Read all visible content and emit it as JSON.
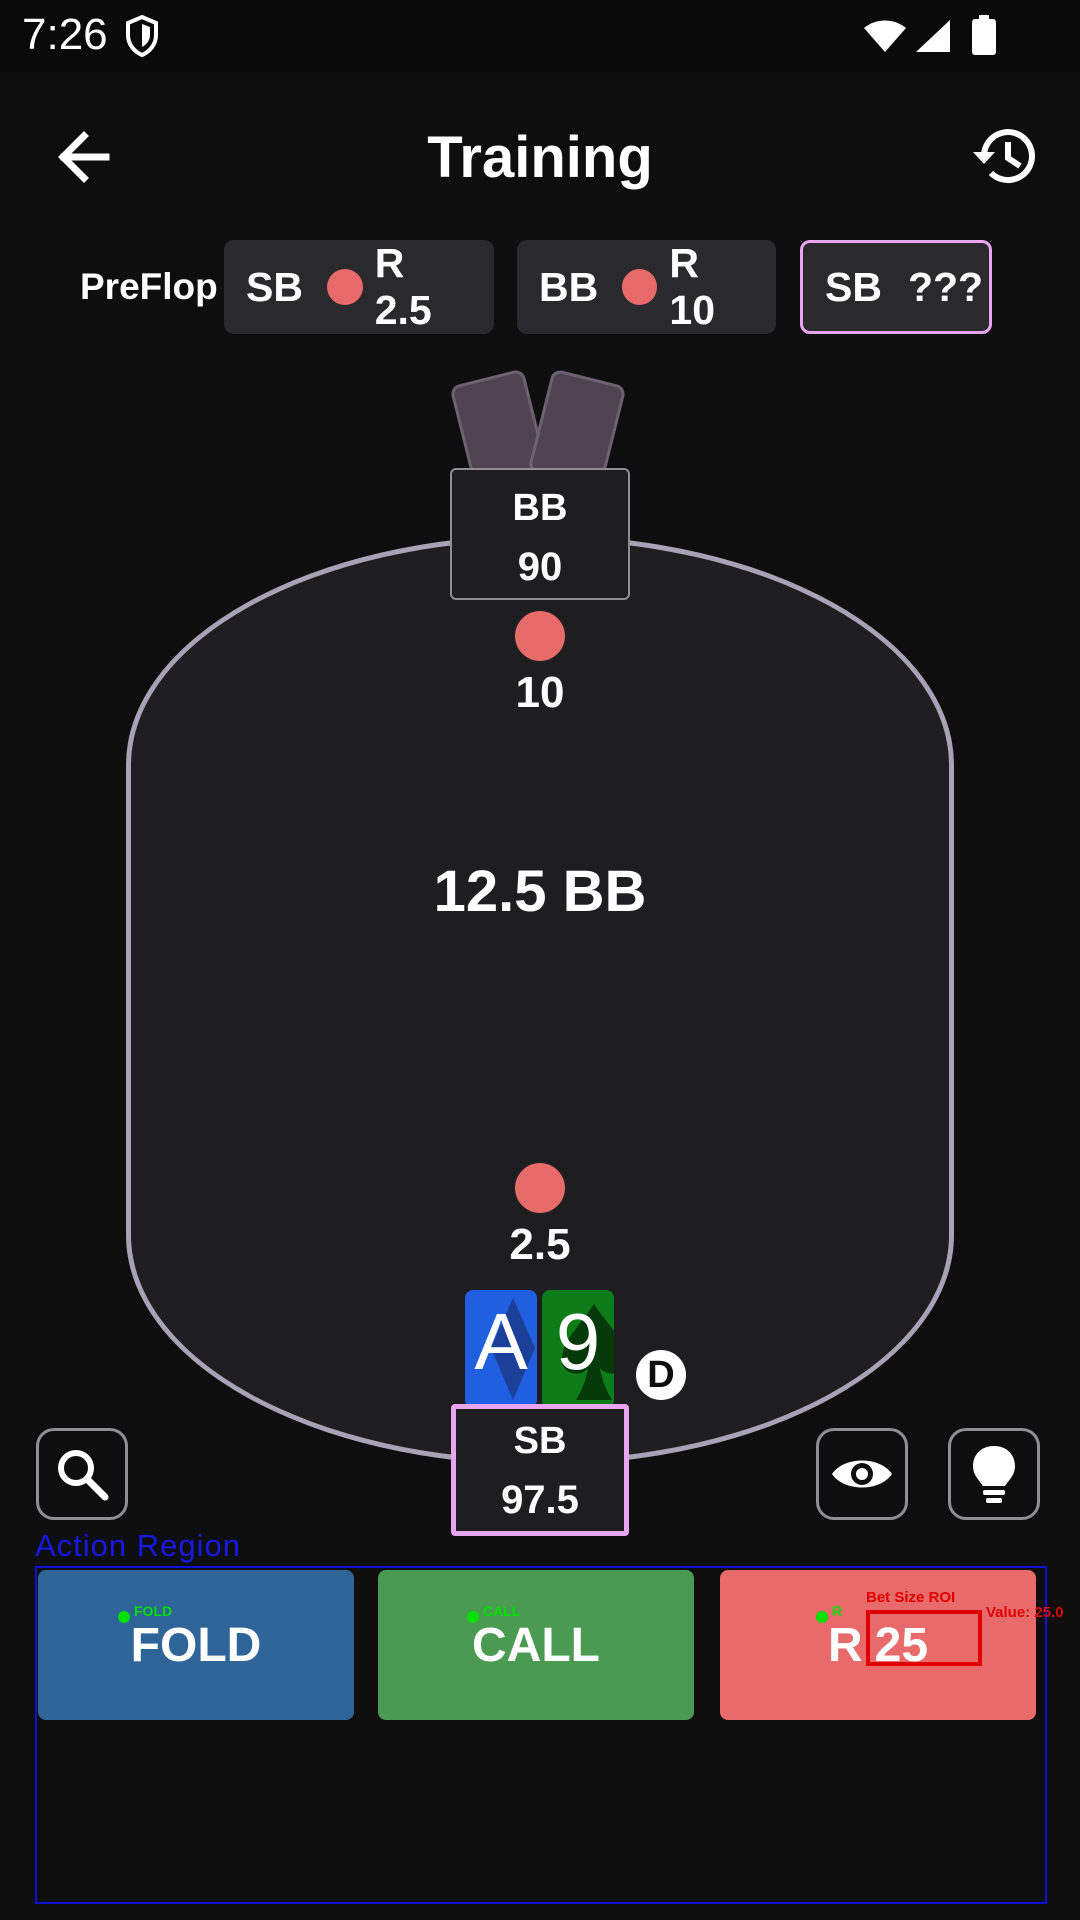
{
  "status_bar": {
    "time": "7:26",
    "icons": [
      "shield-icon",
      "wifi-icon",
      "signal-icon",
      "battery-icon"
    ]
  },
  "header": {
    "title": "Training",
    "back_icon": "arrow-left-icon",
    "history_icon": "history-icon"
  },
  "action_history": {
    "street": "PreFlop",
    "items": [
      {
        "position": "SB",
        "action": "R 2.5"
      },
      {
        "position": "BB",
        "action": "R 10"
      },
      {
        "position": "SB",
        "action": "???"
      }
    ]
  },
  "table": {
    "pot": "12.5 BB",
    "opponent": {
      "position": "BB",
      "stack": "90",
      "bet": "10"
    },
    "hero": {
      "position": "SB",
      "stack": "97.5",
      "bet": "2.5",
      "cards": [
        {
          "rank": "A",
          "suit": "diamonds"
        },
        {
          "rank": "9",
          "suit": "spades"
        }
      ]
    },
    "dealer_label": "D"
  },
  "tools": {
    "search_icon": "search-icon",
    "eye_icon": "eye-icon",
    "hint_icon": "lightbulb-icon"
  },
  "actions": {
    "region_label": "Action Region",
    "fold": "FOLD",
    "call": "CALL",
    "raise_prefix": "R",
    "raise_amount": "25",
    "debug": {
      "fold_tag": "FOLD",
      "call_tag": "CALL",
      "raise_tag": "R",
      "roi_label": "Bet Size ROI",
      "value_label": "Value: 25.0"
    }
  },
  "colors": {
    "accent": "#e9a5f0",
    "chip": "#e86a6a",
    "fold": "#2f6499",
    "call": "#4a9a52",
    "raise": "#e86a6a",
    "felt": "#1e1e20",
    "rail": "#a8a2b6"
  }
}
